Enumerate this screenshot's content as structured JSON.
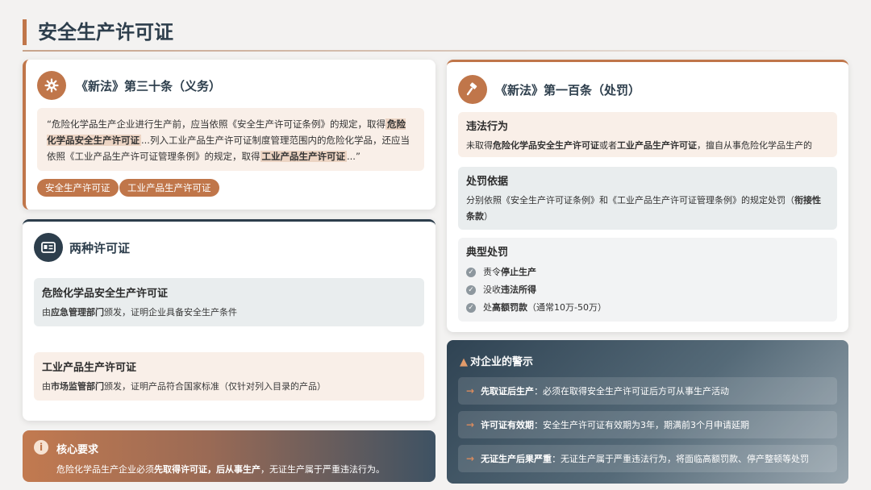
{
  "page_title": "安全生产许可证",
  "law30": {
    "heading": "《新法》第三十条（义务）",
    "icon": "gear-icon",
    "quote": {
      "p1": "“危险化学品生产企业进行生产前，应当依照《安全生产许可证条例》的规定，取得",
      "h1": "危险化学品安全生产许可证",
      "p2": "...列入工业产品生产许可证制度管理范围内的危险化学品，还应当依照《工业产品生产许可证管理条例》的规定，取得",
      "h2": "工业产品生产许可证",
      "p3": "...”"
    },
    "tags": [
      "安全生产许可证",
      "工业产品生产许可证"
    ]
  },
  "two_permits": {
    "heading": "两种许可证",
    "icon": "id-card-icon",
    "items": [
      {
        "title": "危险化学品安全生产许可证",
        "pre": "由",
        "bold": "应急管理部门",
        "post": "颁发，证明企业具备安全生产条件"
      },
      {
        "title": "工业产品生产许可证",
        "pre": "由",
        "bold": "市场监管部门",
        "post": "颁发，证明产品符合国家标准（仅针对列入目录的产品）"
      }
    ]
  },
  "core": {
    "title": "核心要求",
    "icon": "info-icon",
    "pre": "危险化学品生产企业必须",
    "bold1": "先取得许可证，后从事生产",
    "post": "，无证生产属于严重违法行为。"
  },
  "law100": {
    "heading": "《新法》第一百条（处罚）",
    "icon": "gavel-icon",
    "violation": {
      "title": "违法行为",
      "p1": "未取得",
      "b1": "危险化学品安全生产许可证",
      "p2": "或者",
      "b2": "工业产品生产许可证",
      "p3": "，擅自从事危险化学品生产的"
    },
    "basis": {
      "title": "处罚依据",
      "p1": "分别依照《安全生产许可证条例》和《工业产品生产许可证管理条例》的规定处罚（",
      "b1": "衔接性条款",
      "p2": "）"
    },
    "typical": {
      "title": "典型处罚",
      "items": [
        {
          "pre": "责令",
          "bold": "停止生产",
          "post": ""
        },
        {
          "pre": "没收",
          "bold": "违法所得",
          "post": ""
        },
        {
          "pre": "处",
          "bold": "高额罚款",
          "post": "（通常10万-50万）"
        }
      ]
    }
  },
  "warning": {
    "title": "对企业的警示",
    "icon": "warning-icon",
    "items": [
      {
        "bold": "先取证后生产",
        "text": "：必须在取得安全生产许可证后方可从事生产活动"
      },
      {
        "bold": "许可证有效期",
        "text": "：安全生产许可证有效期为3年，期满前3个月申请延期"
      },
      {
        "bold": "无证生产后果严重",
        "text": "：无证生产属于严重违法行为，将面临高额罚款、停产整顿等处罚"
      }
    ]
  }
}
